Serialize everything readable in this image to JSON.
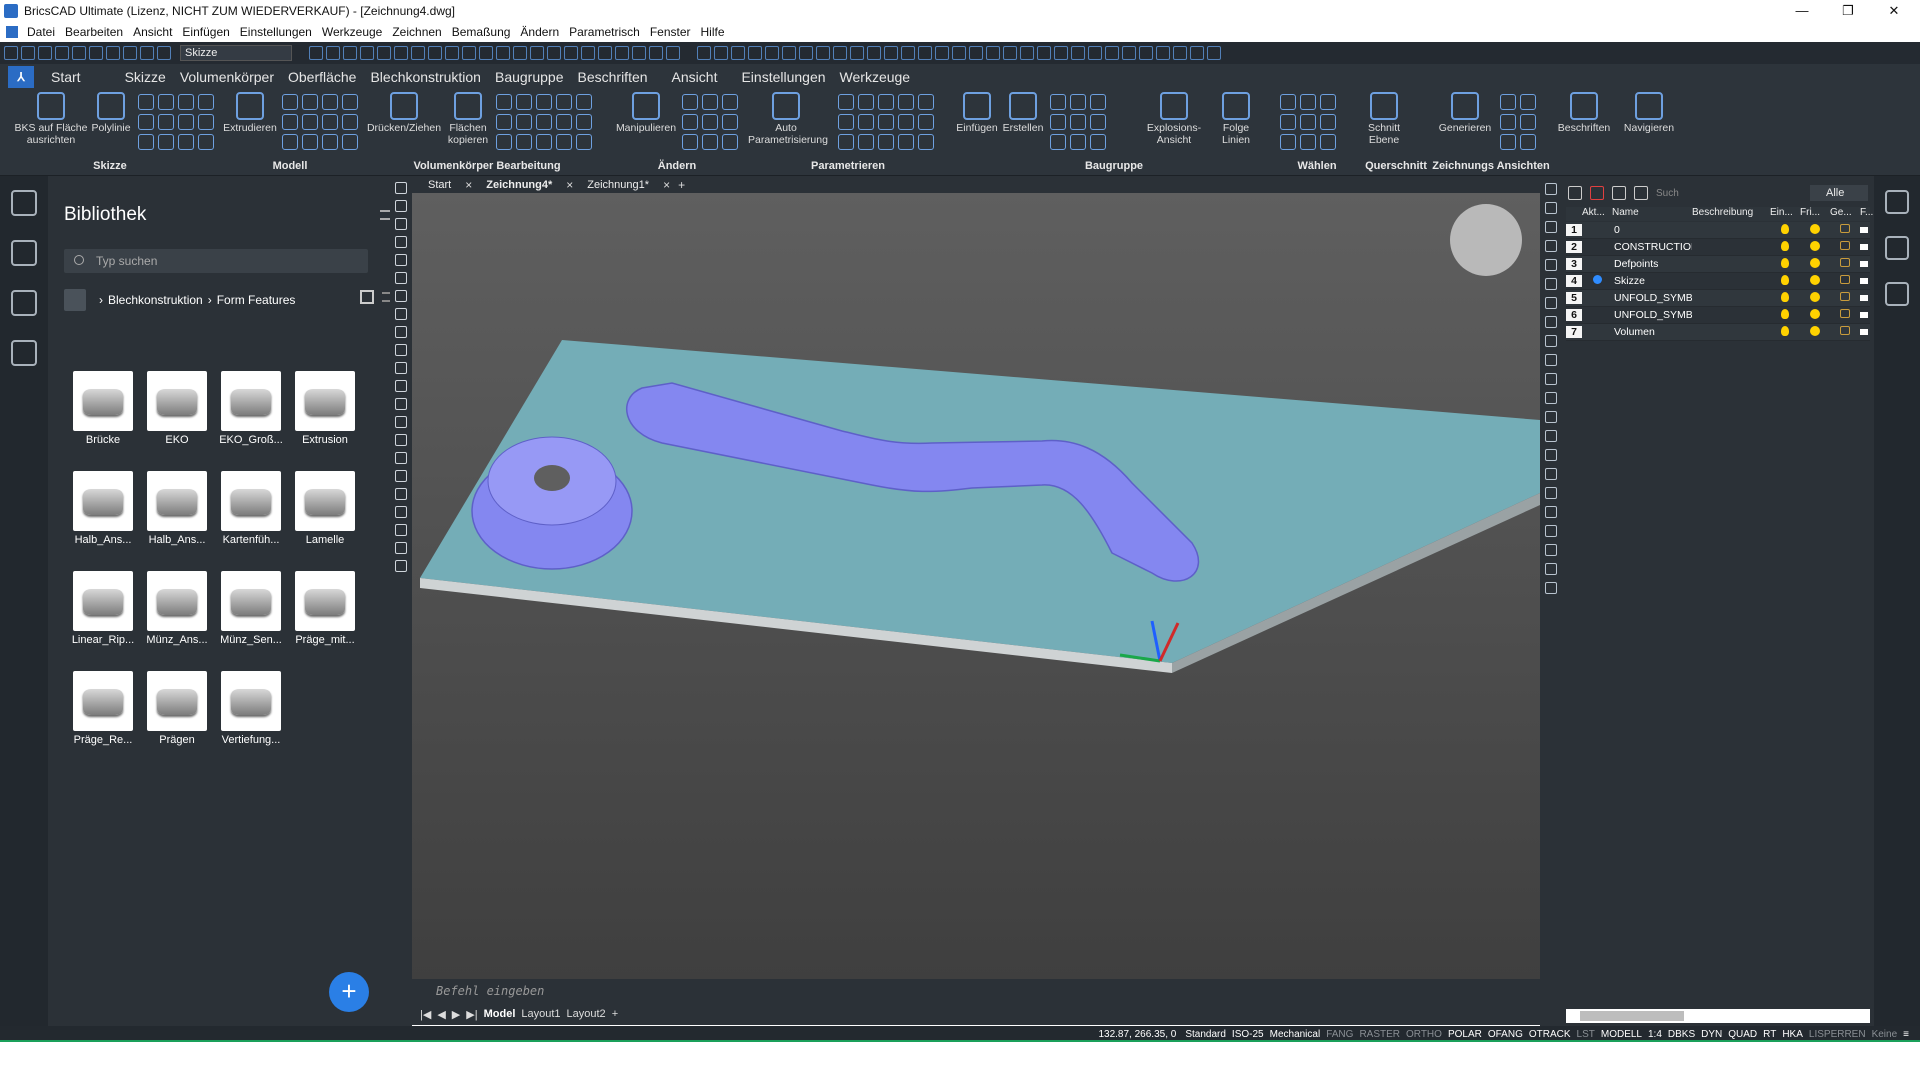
{
  "window": {
    "title": "BricsCAD Ultimate (Lizenz, NICHT ZUM WIEDERVERKAUF) - [Zeichnung4.dwg]",
    "minimize": "—",
    "restore": "❐",
    "close": "✕"
  },
  "menu": [
    "Datei",
    "Bearbeiten",
    "Ansicht",
    "Einfügen",
    "Einstellungen",
    "Werkzeuge",
    "Zeichnen",
    "Bemaßung",
    "Ändern",
    "Parametrisch",
    "Fenster",
    "Hilfe"
  ],
  "quick_access": {
    "workspace": "Skizze"
  },
  "ribbon_tabs": [
    "Start",
    "Skizze",
    "Volumenkörper",
    "Oberfläche",
    "Blechkonstruktion",
    "Baugruppe",
    "Beschriften",
    "Ansicht",
    "Einstellungen",
    "Werkzeuge"
  ],
  "ribbon": {
    "bks_label": "BKS auf Fläche ausrichten",
    "polyline_label": "Polylinie",
    "skizze_group": "Skizze",
    "extrudieren_label": "Extrudieren",
    "modell_group": "Modell",
    "druecken_label": "Drücken/Ziehen",
    "flaechen_label": "Flächen kopieren",
    "volumen_group": "Volumenkörper Bearbeitung",
    "manipulieren_label": "Manipulieren",
    "aendern_group": "Ändern",
    "auto_param_label": "Auto Parametrisierung",
    "param_group": "Parametrieren",
    "einfuegen_label": "Einfügen",
    "erstellen_label": "Erstellen",
    "explosion_label": "Explosions-Ansicht",
    "folge_label": "Folge Linien",
    "baugruppe_group": "Baugruppe",
    "waehlen_group": "Wählen",
    "schnitt_label": "Schnitt Ebene",
    "querschnitt_group": "Querschnitt",
    "generieren_label": "Generieren",
    "zeichnungs_group": "Zeichnungs Ansichten",
    "beschriften_label": "Beschriften",
    "navigieren_label": "Navigieren"
  },
  "library": {
    "title": "Bibliothek",
    "search_placeholder": "Typ suchen",
    "breadcrumb": [
      "Blechkonstruktion",
      "Form Features"
    ],
    "items": [
      "Brücke",
      "EKO",
      "EKO_Groß...",
      "Extrusion",
      "Halb_Ans...",
      "Halb_Ans...",
      "Kartenfüh...",
      "Lamelle",
      "Linear_Rip...",
      "Münz_Ans...",
      "Münz_Sen...",
      "Präge_mit...",
      "Präge_Re...",
      "Prägen",
      "Vertiefung..."
    ],
    "add_button": "+"
  },
  "doc_tabs": [
    "Start",
    "Zeichnung4*",
    "Zeichnung1*"
  ],
  "command_line": {
    "placeholder": "Befehl eingeben"
  },
  "layout_tabs": [
    "Model",
    "Layout1",
    "Layout2"
  ],
  "layers": {
    "filter_label": "Alle",
    "search_placeholder": "Such",
    "columns": [
      "Akt...",
      "Name",
      "Beschreibung",
      "Ein...",
      "Fri...",
      "Ge...",
      "F..."
    ],
    "rows": [
      {
        "num": "1",
        "name": "0",
        "active": false
      },
      {
        "num": "2",
        "name": "CONSTRUCTION",
        "active": false
      },
      {
        "num": "3",
        "name": "Defpoints",
        "active": false
      },
      {
        "num": "4",
        "name": "Skizze",
        "active": true
      },
      {
        "num": "5",
        "name": "UNFOLD_SYMBOL_DOWN",
        "active": false
      },
      {
        "num": "6",
        "name": "UNFOLD_SYMBOL_UP",
        "active": false
      },
      {
        "num": "7",
        "name": "Volumen",
        "active": false
      }
    ]
  },
  "status": {
    "coords": "132.87, 266.35, 0",
    "items": [
      {
        "label": "Standard",
        "on": true
      },
      {
        "label": "ISO-25",
        "on": true
      },
      {
        "label": "Mechanical",
        "on": true
      },
      {
        "label": "FANG",
        "on": false
      },
      {
        "label": "RASTER",
        "on": false
      },
      {
        "label": "ORTHO",
        "on": false
      },
      {
        "label": "POLAR",
        "on": true
      },
      {
        "label": "OFANG",
        "on": true
      },
      {
        "label": "OTRACK",
        "on": true
      },
      {
        "label": "LST",
        "on": false
      },
      {
        "label": "MODELL",
        "on": true
      },
      {
        "label": "1:4",
        "on": true
      },
      {
        "label": "DBKS",
        "on": true
      },
      {
        "label": "DYN",
        "on": true
      },
      {
        "label": "QUAD",
        "on": true
      },
      {
        "label": "RT",
        "on": true
      },
      {
        "label": "HKA",
        "on": true
      },
      {
        "label": "LISPERREN",
        "on": false
      },
      {
        "label": "Keine",
        "on": false
      }
    ]
  },
  "colors": {
    "accent": "#2b6cc4",
    "plate": "#74adb7",
    "feature": "#8487f0",
    "active_layer": "#2f8cff"
  }
}
